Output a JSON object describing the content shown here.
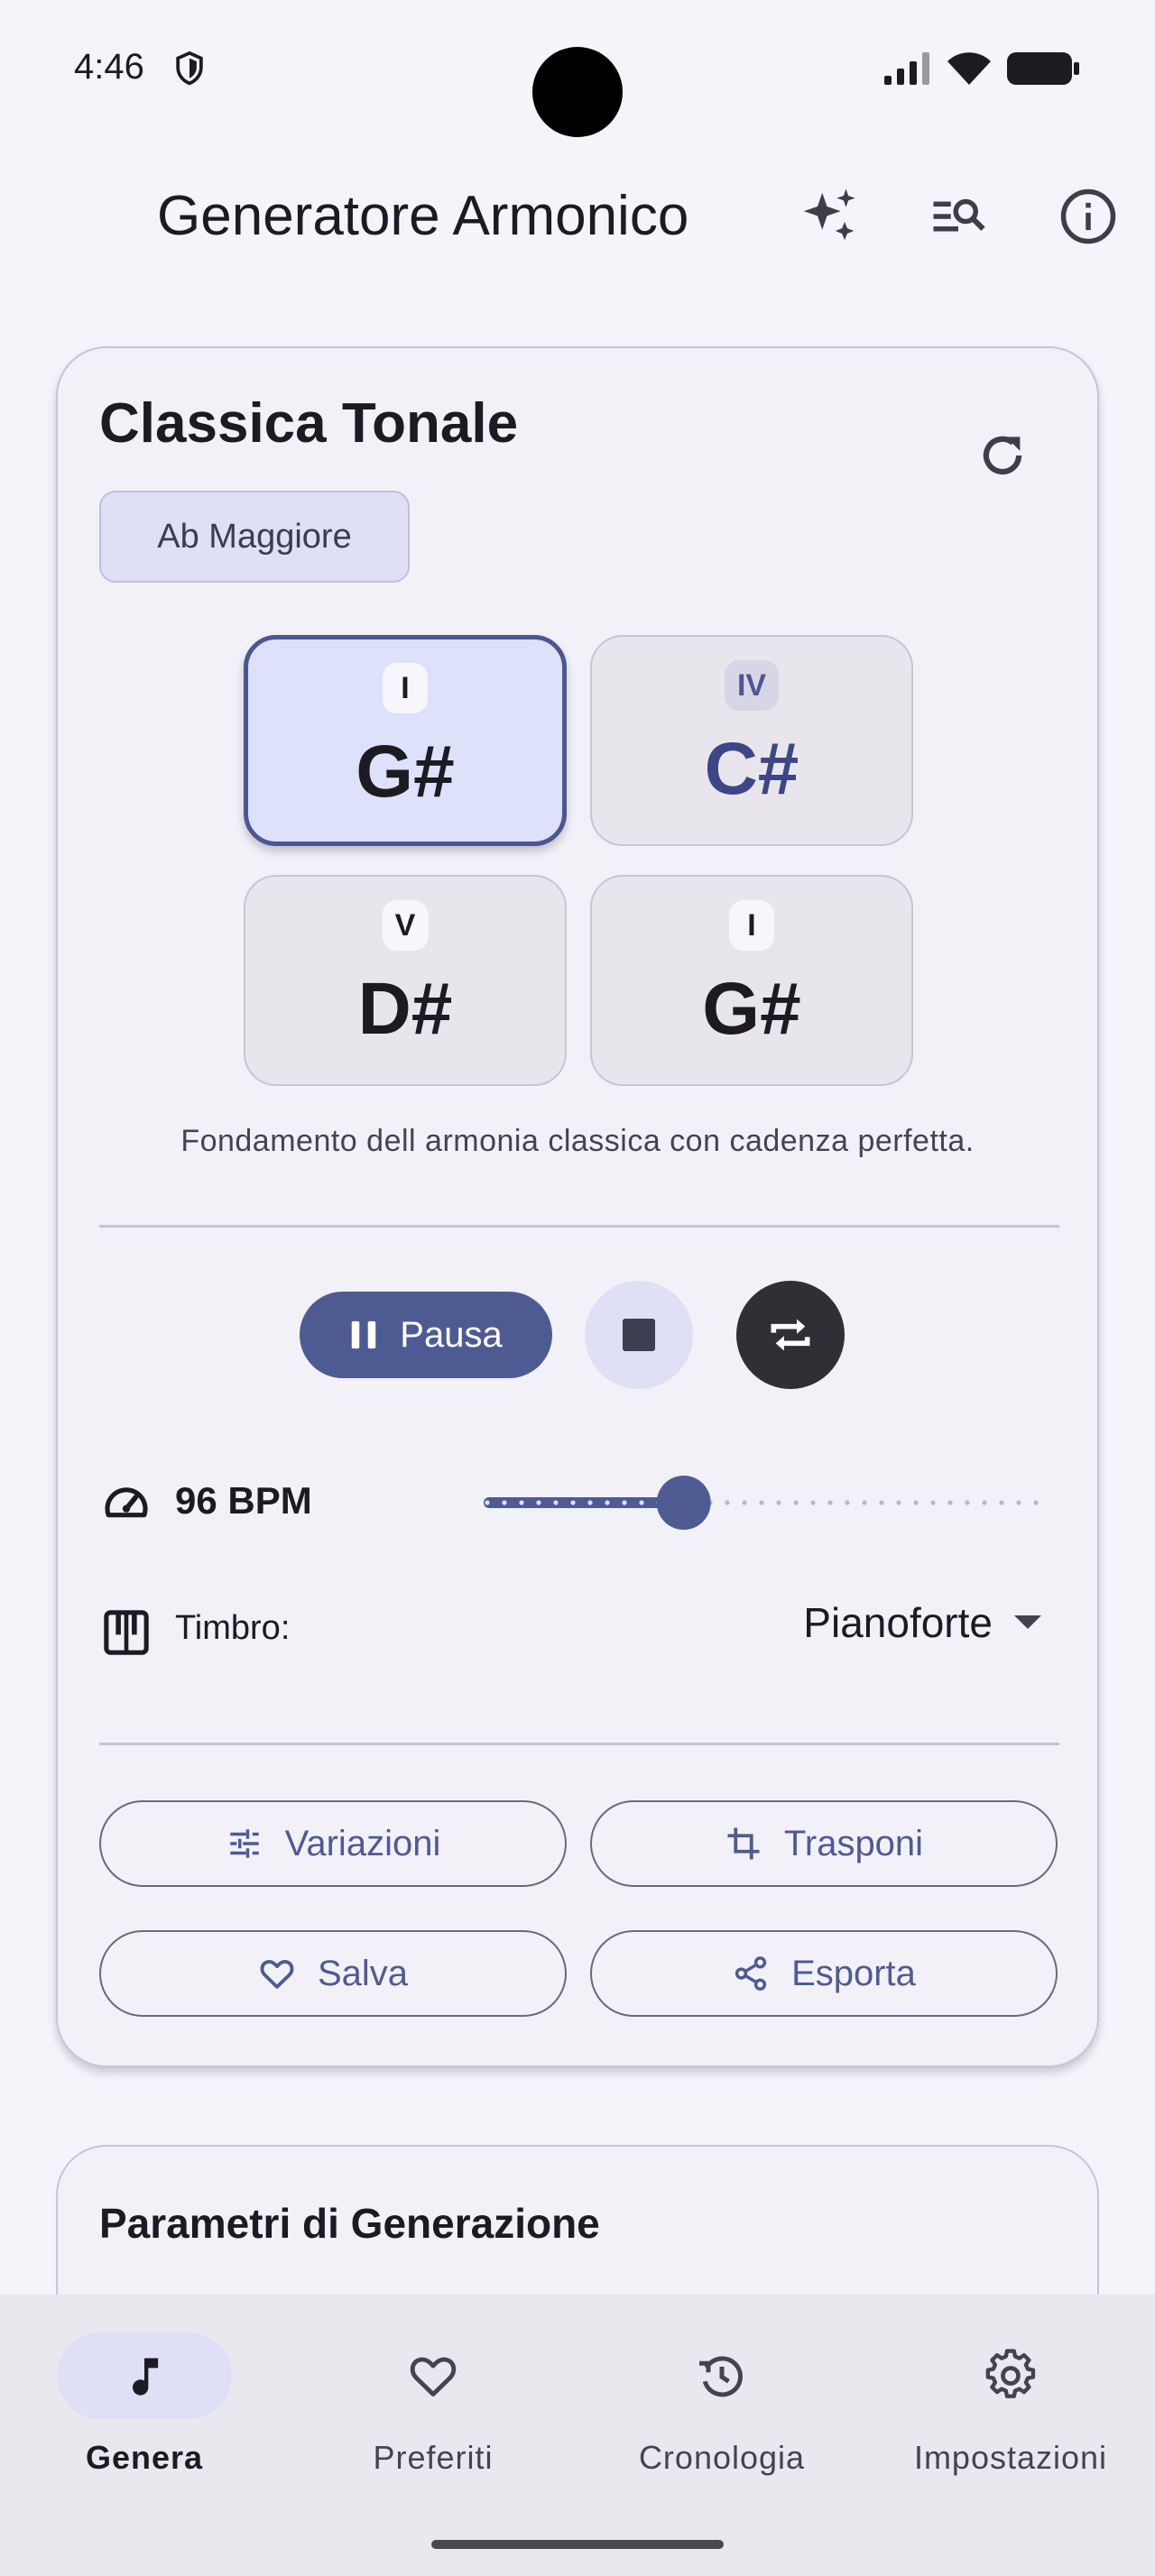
{
  "status_bar": {
    "time": "4:46",
    "icons": [
      "shield-icon",
      "signal-icon",
      "wifi-icon",
      "battery-icon"
    ]
  },
  "app_bar": {
    "title": "Generatore Armonico",
    "actions": [
      "sparkles-icon",
      "search-list-icon",
      "info-icon"
    ]
  },
  "progression_card": {
    "title": "Classica Tonale",
    "key": "Ab Maggiore",
    "chords": [
      {
        "degree": "I",
        "name": "G#",
        "active": true
      },
      {
        "degree": "IV",
        "name": "C#",
        "active": false
      },
      {
        "degree": "V",
        "name": "D#",
        "active": false
      },
      {
        "degree": "I",
        "name": "G#",
        "active": false
      }
    ],
    "description": "Fondamento dell armonia classica con cadenza perfetta.",
    "playback": {
      "pause_label": "Pausa"
    },
    "tempo": {
      "label": "96 BPM",
      "slider_fraction": 0.35
    },
    "timbre": {
      "label": "Timbro:",
      "selected": "Pianoforte"
    },
    "actions": {
      "variations": "Variazioni",
      "transpose": "Trasponi",
      "save": "Salva",
      "export": "Esporta"
    }
  },
  "params_card": {
    "title": "Parametri di Generazione"
  },
  "bottom_nav": {
    "items": [
      {
        "label": "Genera",
        "icon": "music-note-icon",
        "active": true
      },
      {
        "label": "Preferiti",
        "icon": "heart-icon",
        "active": false
      },
      {
        "label": "Cronologia",
        "icon": "history-icon",
        "active": false
      },
      {
        "label": "Impostazioni",
        "icon": "gear-icon",
        "active": false
      }
    ]
  },
  "colors": {
    "accent": "#4e5b93",
    "accent_container": "#dfe0f6",
    "background": "#f6f4fb"
  }
}
